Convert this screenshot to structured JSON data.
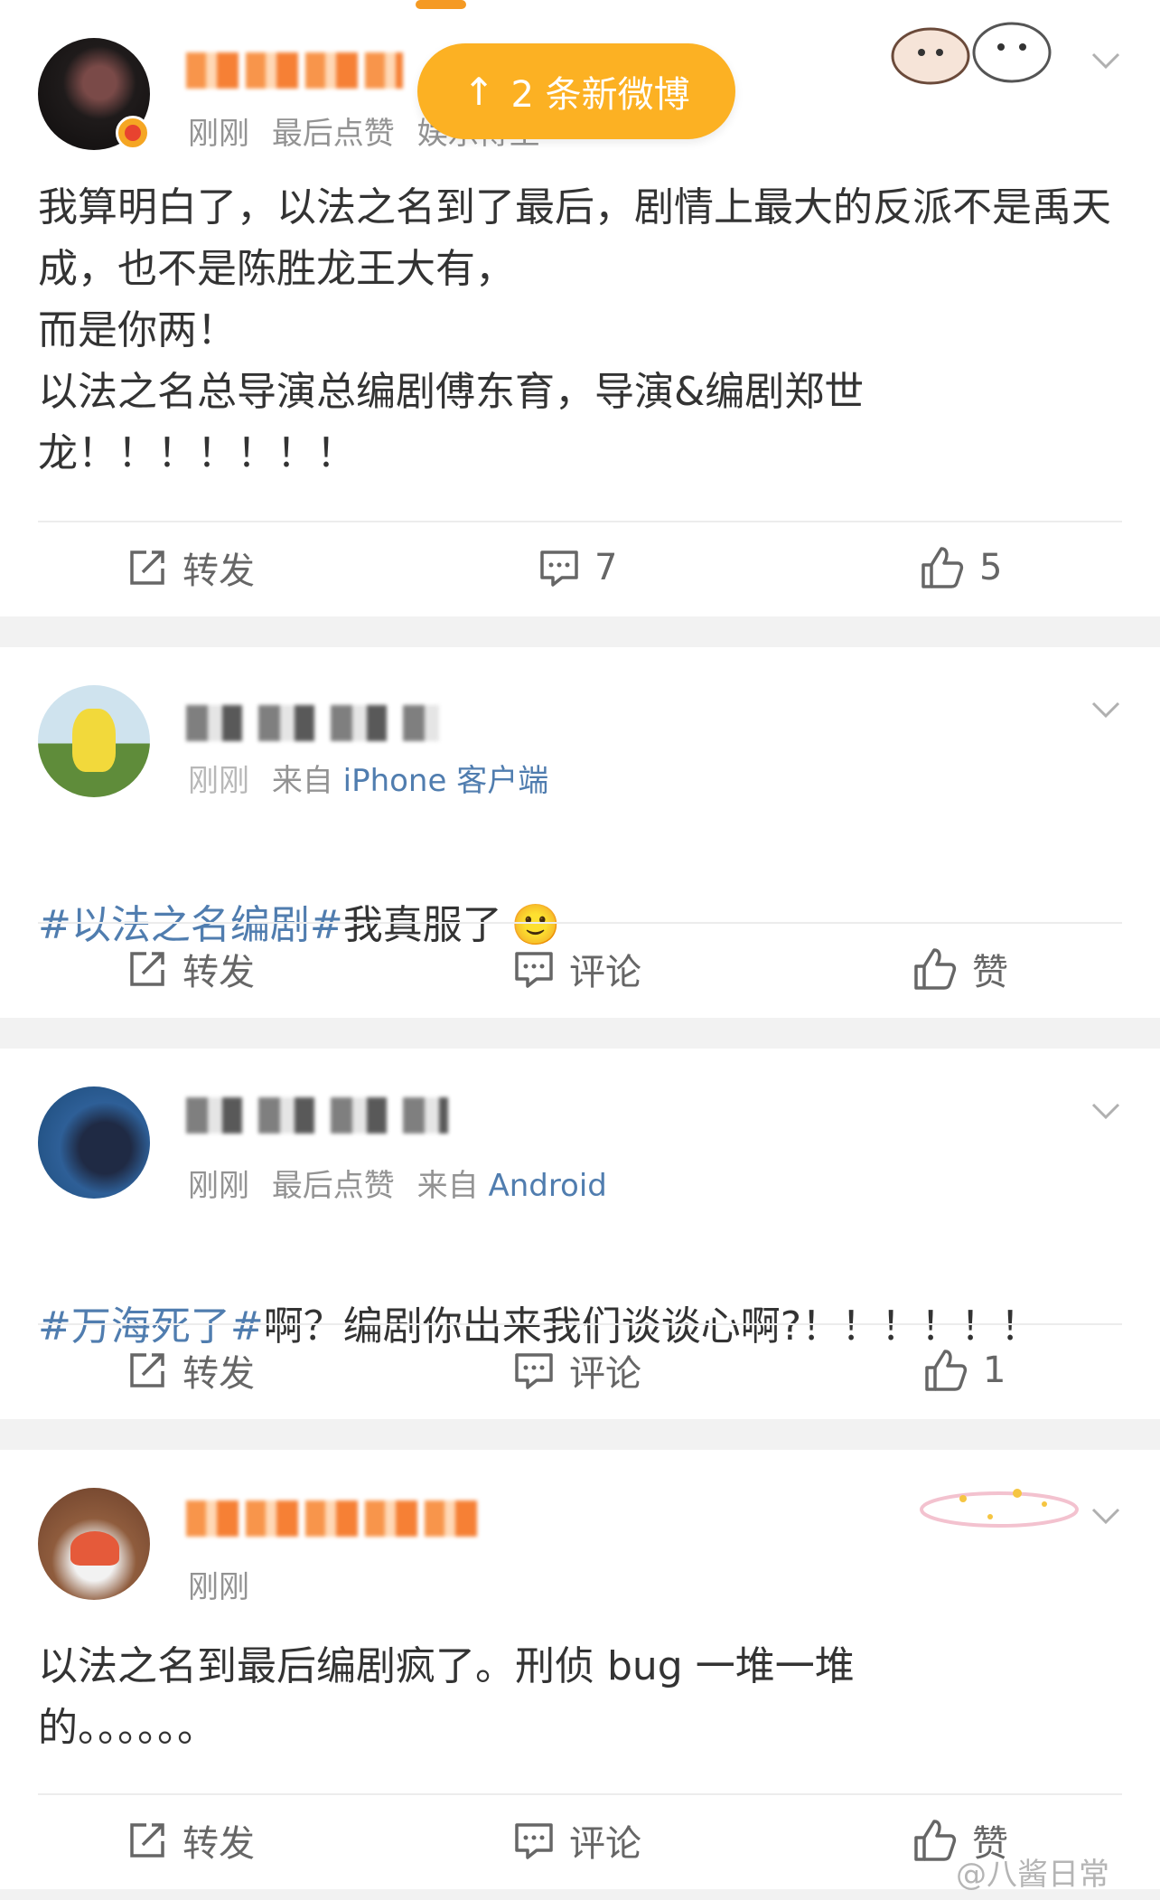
{
  "new_posts_toast": {
    "arrow": "↑",
    "label": "2 条新微博"
  },
  "posts": [
    {
      "meta_time": "刚刚",
      "meta_extra": "最后点赞",
      "meta_source": "娱乐博主",
      "text": "我算明白了，以法之名到了最后，剧情上最大的反派不是禹天成，也不是陈胜龙王大有，\n而是你两！\n以法之名总导演总编剧傅东育，导演&编剧郑世龙！！！！！！！",
      "actions": {
        "repost": "转发",
        "comment": "7",
        "like": "5"
      }
    },
    {
      "meta_time": "刚刚",
      "meta_source_prefix": "来自",
      "meta_source": "iPhone 客户端",
      "hashtag": "#以法之名编剧#",
      "text": "我真服了",
      "emoji": "🙂",
      "actions": {
        "repost": "转发",
        "comment": "评论",
        "like": "赞"
      }
    },
    {
      "meta_time": "刚刚",
      "meta_extra": "最后点赞",
      "meta_source_prefix": "来自",
      "meta_source": "Android",
      "hashtag": "#万海死了#",
      "text": "啊？编剧你出来我们谈谈心啊?！！！！！！",
      "actions": {
        "repost": "转发",
        "comment": "评论",
        "like": "1"
      }
    },
    {
      "meta_time": "刚刚",
      "text": "以法之名到最后编剧疯了。刑侦 bug 一堆一堆\n的。。。。。。",
      "actions": {
        "repost": "转发",
        "comment": "评论",
        "like": "赞"
      }
    }
  ],
  "watermark": "@八酱日常",
  "icons": {
    "repost": "repost-icon",
    "comment": "comment-icon",
    "like": "thumbs-up-icon",
    "more": "chevron-down-icon"
  },
  "colors": {
    "toast": "#fcb123",
    "link": "#507daf",
    "meta": "#939393",
    "text": "#333333",
    "divider_bg": "#f2f2f2"
  }
}
